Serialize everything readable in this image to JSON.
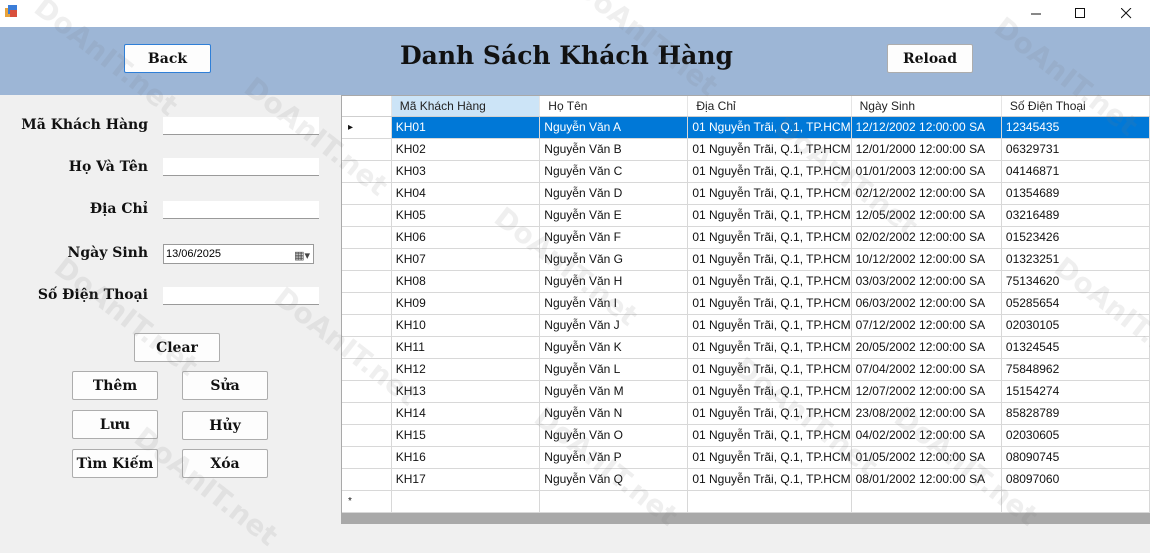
{
  "window": {
    "minimize_icon": "minimize-icon",
    "maximize_icon": "maximize-icon",
    "close_icon": "close-icon"
  },
  "header": {
    "back_label": "Back",
    "title": "Danh Sách Khách Hàng",
    "reload_label": "Reload"
  },
  "form": {
    "ma_label": "Mã Khách Hàng",
    "ma_value": "",
    "ho_ten_label": "Họ Và Tên",
    "ho_ten_value": "",
    "dia_chi_label": "Địa Chỉ",
    "dia_chi_value": "",
    "ngay_sinh_label": "Ngày Sinh",
    "ngay_sinh_value": "13/06/2025",
    "sdt_label": "Số Điện Thoại",
    "sdt_value": "",
    "clear_label": "Clear",
    "them_label": "Thêm",
    "sua_label": "Sửa",
    "luu_label": "Lưu",
    "huy_label": "Hủy",
    "tim_kiem_label": "Tìm Kiếm",
    "xoa_label": "Xóa"
  },
  "grid": {
    "columns": [
      "Mã Khách Hàng",
      "Họ Tên",
      "Địa Chỉ",
      "Ngày Sinh",
      "Số Điện Thoại"
    ],
    "current_row_marker": "▸",
    "new_row_marker": "*",
    "rows": [
      [
        "KH01",
        "Nguyễn Văn A",
        "01 Nguyễn Trãi, Q.1, TP.HCM",
        "12/12/2002 12:00:00 SA",
        "12345435"
      ],
      [
        "KH02",
        "Nguyễn Văn B",
        "01 Nguyễn Trãi, Q.1, TP.HCM",
        "12/01/2000 12:00:00 SA",
        "06329731"
      ],
      [
        "KH03",
        "Nguyễn Văn C",
        "01 Nguyễn Trãi, Q.1, TP.HCM",
        "01/01/2003 12:00:00 SA",
        "04146871"
      ],
      [
        "KH04",
        "Nguyễn Văn D",
        "01 Nguyễn Trãi, Q.1, TP.HCM",
        "02/12/2002 12:00:00 SA",
        "01354689"
      ],
      [
        "KH05",
        "Nguyễn Văn E",
        "01 Nguyễn Trãi, Q.1, TP.HCM",
        "12/05/2002 12:00:00 SA",
        "03216489"
      ],
      [
        "KH06",
        "Nguyễn Văn F",
        "01 Nguyễn Trãi, Q.1, TP.HCM",
        "02/02/2002 12:00:00 SA",
        "01523426"
      ],
      [
        "KH07",
        "Nguyễn Văn G",
        "01 Nguyễn Trãi, Q.1, TP.HCM",
        "10/12/2002 12:00:00 SA",
        "01323251"
      ],
      [
        "KH08",
        "Nguyễn Văn H",
        "01 Nguyễn Trãi, Q.1, TP.HCM",
        "03/03/2002 12:00:00 SA",
        "75134620"
      ],
      [
        "KH09",
        "Nguyễn Văn I",
        "01 Nguyễn Trãi, Q.1, TP.HCM",
        "06/03/2002 12:00:00 SA",
        "05285654"
      ],
      [
        "KH10",
        "Nguyễn Văn J",
        "01 Nguyễn Trãi, Q.1, TP.HCM",
        "07/12/2002 12:00:00 SA",
        "02030105"
      ],
      [
        "KH11",
        "Nguyễn Văn K",
        "01 Nguyễn Trãi, Q.1, TP.HCM",
        "20/05/2002 12:00:00 SA",
        "01324545"
      ],
      [
        "KH12",
        "Nguyễn Văn L",
        "01 Nguyễn Trãi, Q.1, TP.HCM",
        "07/04/2002 12:00:00 SA",
        "75848962"
      ],
      [
        "KH13",
        "Nguyễn Văn M",
        "01 Nguyễn Trãi, Q.1, TP.HCM",
        "12/07/2002 12:00:00 SA",
        "15154274"
      ],
      [
        "KH14",
        "Nguyễn Văn N",
        "01 Nguyễn Trãi, Q.1, TP.HCM",
        "23/08/2002 12:00:00 SA",
        "85828789"
      ],
      [
        "KH15",
        "Nguyễn Văn O",
        "01 Nguyễn Trãi, Q.1, TP.HCM",
        "04/02/2002 12:00:00 SA",
        "02030605"
      ],
      [
        "KH16",
        "Nguyễn Văn P",
        "01 Nguyễn Trãi, Q.1, TP.HCM",
        "01/05/2002 12:00:00 SA",
        "08090745"
      ],
      [
        "KH17",
        "Nguyễn Văn Q",
        "01 Nguyễn Trãi, Q.1, TP.HCM",
        "08/01/2002 12:00:00 SA",
        "08097060"
      ]
    ]
  },
  "watermark": {
    "text": "DoAnIT.net"
  }
}
